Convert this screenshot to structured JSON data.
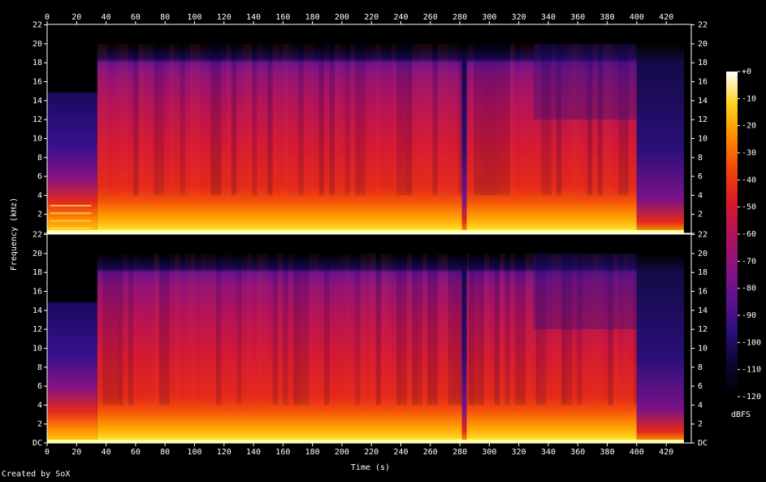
{
  "chart_data": {
    "type": "heatmap",
    "title": "",
    "xlabel": "Time (s)",
    "ylabel": "Frequency (kHz)",
    "xlim": [
      0,
      437
    ],
    "ylim": [
      0,
      22.05
    ],
    "x_ticks": [
      "0",
      "20",
      "40",
      "60",
      "80",
      "100",
      "120",
      "140",
      "160",
      "180",
      "200",
      "220",
      "240",
      "260",
      "280",
      "300",
      "320",
      "340",
      "360",
      "380",
      "400",
      "420"
    ],
    "y_ticks": [
      "DC",
      "2",
      "4",
      "6",
      "8",
      "10",
      "12",
      "14",
      "16",
      "18",
      "20",
      "22"
    ],
    "channels": [
      "top channel",
      "bottom channel"
    ],
    "colorbar": {
      "label": "dBFS",
      "range": [
        -120,
        0
      ],
      "ticks": [
        "+0",
        "-10",
        "-20",
        "-30",
        "-40",
        "-50",
        "-60",
        "-70",
        "-80",
        "-90",
        "-100",
        "-110",
        "-120"
      ]
    },
    "features": {
      "lowpass_cutoff_khz": 20,
      "intro_section_end_s": 34,
      "intro_cutoff_top_khz": 16,
      "intro_cutoff_bottom_khz": 16,
      "dropout_time_s": 283,
      "outro_fade_start_s": 400,
      "track_end_s": 432
    }
  },
  "footer": {
    "credit": "Created by SoX"
  }
}
